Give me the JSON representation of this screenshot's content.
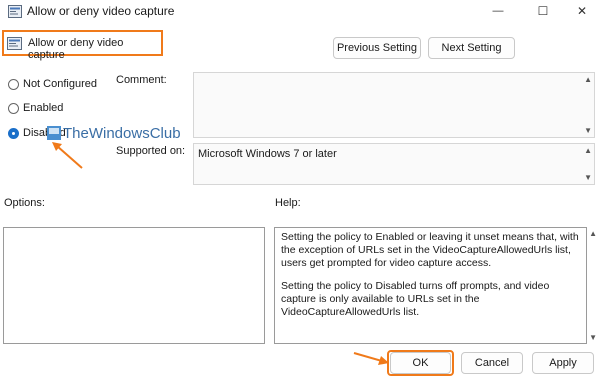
{
  "window": {
    "title": "Allow or deny video capture",
    "controls": {
      "minimize": "—",
      "maximize": "☐",
      "close": "✕"
    }
  },
  "header": {
    "setting_name": "Allow or deny video capture",
    "previous_label": "Previous Setting",
    "next_label": "Next Setting"
  },
  "state": {
    "options": [
      {
        "label": "Not Configured",
        "selected": false
      },
      {
        "label": "Enabled",
        "selected": false
      },
      {
        "label": "Disabled",
        "selected": true
      }
    ]
  },
  "comment": {
    "label": "Comment:",
    "value": ""
  },
  "supported": {
    "label": "Supported on:",
    "value": "Microsoft Windows 7 or later"
  },
  "options_pane": {
    "label": "Options:"
  },
  "help_pane": {
    "label": "Help:",
    "paragraphs": [
      "Setting the policy to Enabled or leaving it unset means that, with the exception of URLs set in the VideoCaptureAllowedUrls list, users get prompted for video capture access.",
      "Setting the policy to Disabled turns off prompts, and video capture is only available to URLs set in the VideoCaptureAllowedUrls list."
    ]
  },
  "footer": {
    "ok_label": "OK",
    "cancel_label": "Cancel",
    "apply_label": "Apply"
  },
  "watermark": {
    "text": "TheWindowsClub"
  },
  "colors": {
    "highlight": "#f07a1a",
    "accent": "#1a6fc9"
  }
}
